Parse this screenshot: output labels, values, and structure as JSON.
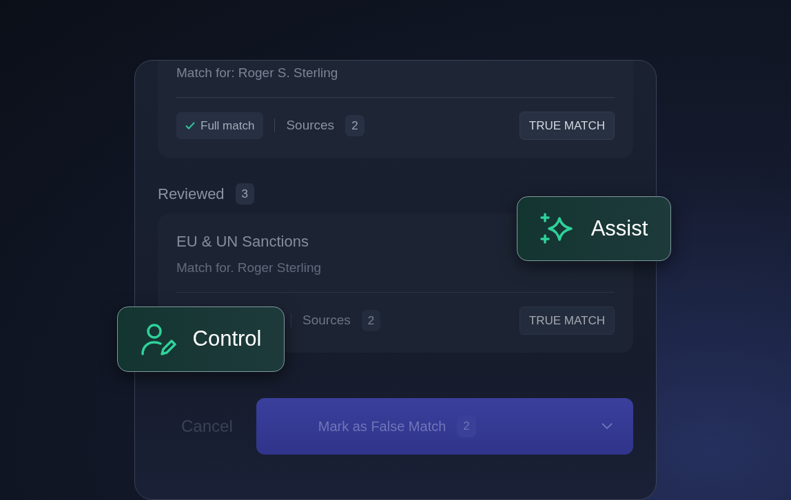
{
  "cards": [
    {
      "match_for": "Match for: Roger S. Sterling",
      "chip": "Full match",
      "sources_label": "Sources",
      "sources_count": "2",
      "action": "TRUE MATCH"
    },
    {
      "title": "EU & UN Sanctions",
      "match_for": "Match for. Roger Sterling",
      "sources_label": "Sources",
      "sources_count": "2",
      "action": "TRUE MATCH"
    }
  ],
  "section": {
    "label": "Reviewed",
    "count": "3"
  },
  "footer": {
    "cancel": "Cancel",
    "primary": {
      "label": "Mark as False Match",
      "count": "2"
    }
  },
  "badges": [
    {
      "kind": "sparkle",
      "label": "Assist"
    },
    {
      "kind": "user-edit",
      "label": "Control"
    }
  ]
}
